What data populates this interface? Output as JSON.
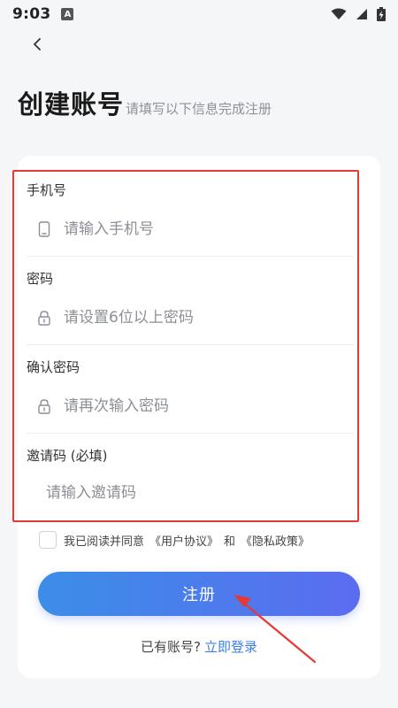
{
  "status_bar": {
    "time": "9:03",
    "app_icon_letter": "A"
  },
  "header": {
    "title": "创建账号",
    "subtitle": "请填写以下信息完成注册"
  },
  "form": {
    "phone": {
      "label": "手机号",
      "placeholder": "请输入手机号",
      "value": ""
    },
    "password": {
      "label": "密码",
      "placeholder": "请设置6位以上密码",
      "value": ""
    },
    "confirm_password": {
      "label": "确认密码",
      "placeholder": "请再次输入密码",
      "value": ""
    },
    "invite_code": {
      "label": "邀请码 (必填)",
      "placeholder": "请输入邀请码",
      "value": ""
    }
  },
  "agreement": {
    "checked": false,
    "prefix": "我已阅读并同意",
    "user_agreement": "《用户协议》",
    "and": "和",
    "privacy_policy": "《隐私政策》"
  },
  "register_button": {
    "label": "注册"
  },
  "login_prompt": {
    "question": "已有账号?",
    "link": "立即登录"
  },
  "colors": {
    "annotation_red": "#e53935",
    "button_gradient_start": "#3b8ee8",
    "button_gradient_end": "#5b6cf0",
    "link_blue": "#3b7fe6"
  },
  "icons": {
    "back": "chevron-left-icon",
    "phone": "mobile-phone-icon",
    "lock": "lock-icon",
    "wifi": "wifi-icon",
    "signal": "cell-signal-icon",
    "battery": "battery-charging-icon"
  }
}
